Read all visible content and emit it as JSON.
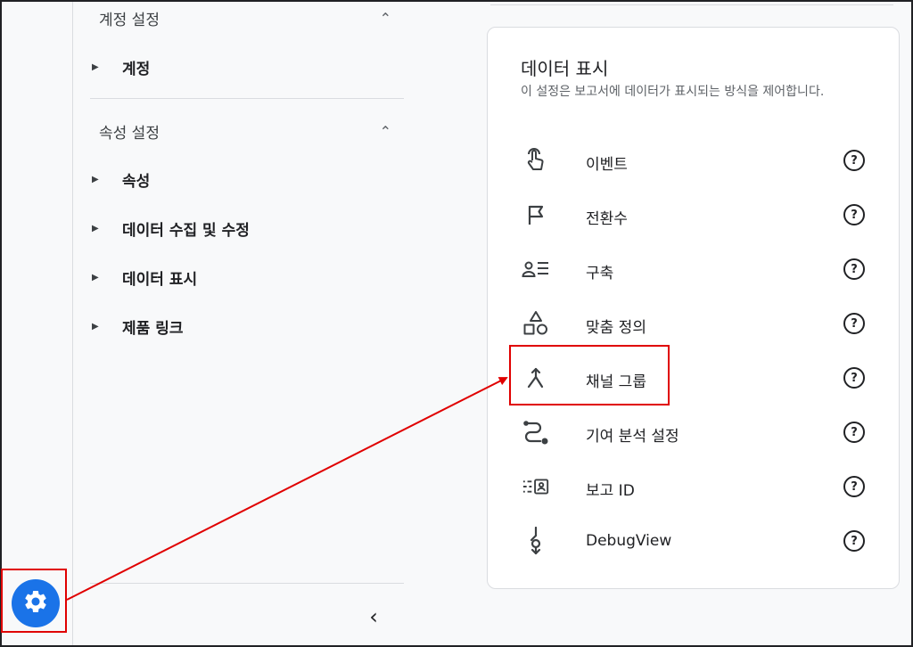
{
  "sidebar": {
    "account_section": {
      "title": "계정 설정",
      "items": [
        {
          "label": "계정"
        }
      ]
    },
    "property_section": {
      "title": "속성 설정",
      "items": [
        {
          "label": "속성"
        },
        {
          "label": "데이터 수집 및 수정"
        },
        {
          "label": "데이터 표시"
        },
        {
          "label": "제품 링크"
        }
      ]
    },
    "collapse_glyph": "‹"
  },
  "card": {
    "title": "데이터 표시",
    "description": "이 설정은 보고서에 데이터가 표시되는 방식을 제어합니다.",
    "items": [
      {
        "label": "이벤트",
        "icon": "touch-icon"
      },
      {
        "label": "전환수",
        "icon": "flag-icon"
      },
      {
        "label": "구축",
        "icon": "audience-icon"
      },
      {
        "label": "맞춤 정의",
        "icon": "shapes-icon"
      },
      {
        "label": "채널 그룹",
        "icon": "merge-icon"
      },
      {
        "label": "기여 분석 설정",
        "icon": "attribution-path-icon"
      },
      {
        "label": "보고 ID",
        "icon": "reporting-id-icon"
      },
      {
        "label": "DebugView",
        "icon": "debug-icon"
      }
    ],
    "help_glyph": "?"
  },
  "colors": {
    "accent": "#1a73e8",
    "annotation": "#e00000"
  }
}
